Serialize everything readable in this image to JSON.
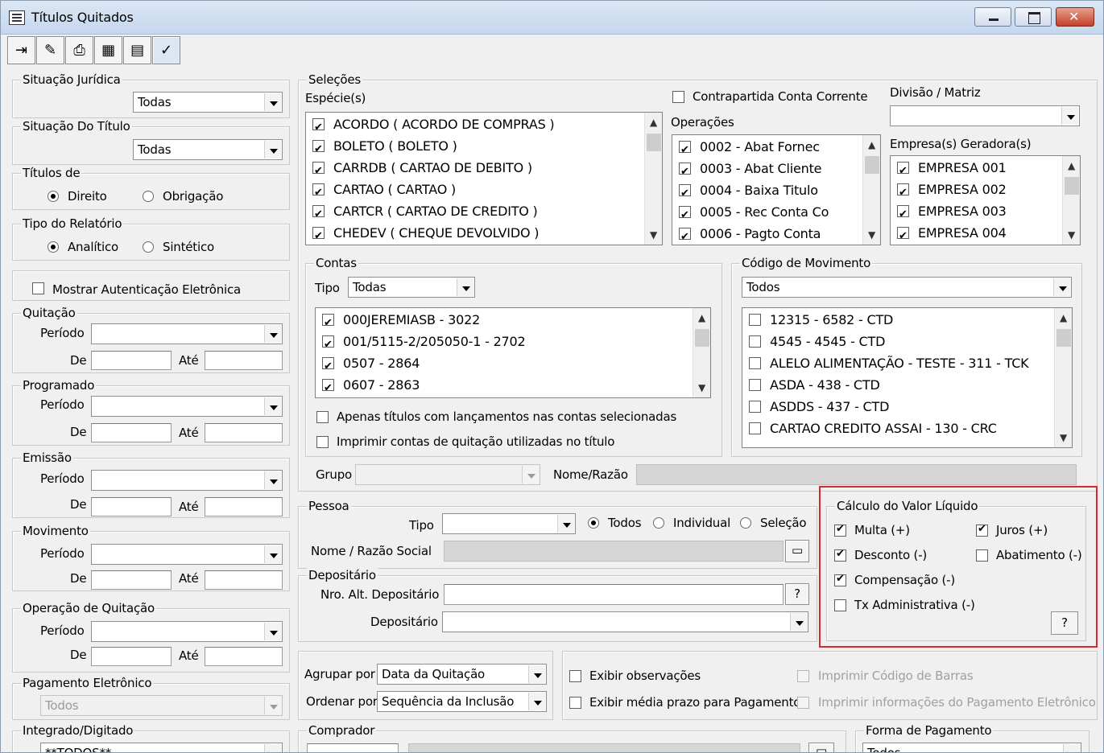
{
  "window": {
    "title": "Títulos Quitados"
  },
  "toolbar": {
    "buttons": [
      {
        "icon": "exit-icon"
      },
      {
        "icon": "eraser-icon"
      },
      {
        "icon": "printer-icon"
      },
      {
        "icon": "spreadsheet-icon"
      },
      {
        "icon": "report-icon"
      },
      {
        "icon": "confirm-icon"
      }
    ]
  },
  "left": {
    "situacao_juridica": {
      "title": "Situação Jurídica",
      "value": "Todas"
    },
    "situacao_titulo": {
      "title": "Situação Do Título",
      "value": "Todas"
    },
    "titulos_de": {
      "title": "Títulos de",
      "options": [
        "Direito",
        "Obrigação"
      ],
      "selected": "Direito"
    },
    "tipo_relatorio": {
      "title": "Tipo do Relatório",
      "options": [
        "Analítico",
        "Sintético"
      ],
      "selected": "Analítico"
    },
    "mostrar_autenticacao": {
      "label": "Mostrar Autenticação Eletrônica",
      "checked": false
    },
    "periodo_label": "Período",
    "de_label": "De",
    "ate_label": "Até",
    "quitacao": {
      "title": "Quitação"
    },
    "programado": {
      "title": "Programado"
    },
    "emissao": {
      "title": "Emissão"
    },
    "movimento": {
      "title": "Movimento"
    },
    "operacao_quitacao": {
      "title": "Operação de Quitação"
    },
    "pagamento_eletronico": {
      "title": "Pagamento Eletrônico",
      "value": "Todos"
    },
    "integrado": {
      "title": "Integrado/Digitado",
      "value": "**TODOS**"
    }
  },
  "selecoes": {
    "title": "Seleções",
    "especies": {
      "label": "Espécie(s)",
      "items": [
        {
          "text": "ACORDO ( ACORDO DE COMPRAS )",
          "checked": true
        },
        {
          "text": "BOLETO ( BOLETO )",
          "checked": true
        },
        {
          "text": "CARRDB ( CARTAO DE DEBITO )",
          "checked": true
        },
        {
          "text": "CARTAO ( CARTAO )",
          "checked": true
        },
        {
          "text": "CARTCR ( CARTAO DE CREDITO )",
          "checked": true
        },
        {
          "text": "CHEDEV ( CHEQUE DEVOLVIDO )",
          "checked": true
        }
      ]
    },
    "contrapartida": {
      "label": "Contrapartida Conta Corrente",
      "checked": false
    },
    "operacoes": {
      "label": "Operações",
      "items": [
        {
          "text": "0002 - Abat Fornec",
          "checked": true
        },
        {
          "text": "0003 - Abat Cliente",
          "checked": true
        },
        {
          "text": "0004 - Baixa Titulo",
          "checked": true
        },
        {
          "text": "0005 - Rec Conta Co",
          "checked": true
        },
        {
          "text": "0006 - Pagto Conta",
          "checked": true
        }
      ]
    },
    "divisao": {
      "label": "Divisão / Matriz",
      "value": ""
    },
    "empresas": {
      "label": "Empresa(s) Geradora(s)",
      "items": [
        {
          "text": "EMPRESA 001",
          "checked": true
        },
        {
          "text": "EMPRESA 002",
          "checked": true
        },
        {
          "text": "EMPRESA 003",
          "checked": true
        },
        {
          "text": "EMPRESA 004",
          "checked": true
        }
      ]
    },
    "contas": {
      "title": "Contas",
      "tipo_label": "Tipo",
      "tipo_value": "Todas",
      "items": [
        {
          "text": "000JEREMIASB - 3022",
          "checked": true
        },
        {
          "text": "001/5115-2/205050-1 - 2702",
          "checked": true
        },
        {
          "text": "0507 - 2864",
          "checked": true
        },
        {
          "text": "0607 - 2863",
          "checked": true
        }
      ],
      "apenas_label": "Apenas títulos com lançamentos nas contas selecionadas",
      "imprimir_contas_label": "Imprimir contas de quitação utilizadas no título"
    },
    "codigo_movimento": {
      "title": "Código de Movimento",
      "value": "Todos",
      "items": [
        {
          "text": "12315 - 6582 - CTD",
          "checked": false
        },
        {
          "text": "4545 - 4545 - CTD",
          "checked": false
        },
        {
          "text": "ALELO ALIMENTAÇÃO - TESTE - 311 - TCK",
          "checked": false
        },
        {
          "text": "ASDA - 438 - CTD",
          "checked": false
        },
        {
          "text": "ASDDS - 437 - CTD",
          "checked": false
        },
        {
          "text": "CARTAO CREDITO ASSAI - 130 - CRC",
          "checked": false
        }
      ]
    },
    "grupo_label": "Grupo",
    "nome_razao_label": "Nome/Razão"
  },
  "pessoa": {
    "title": "Pessoa",
    "tipo_label": "Tipo",
    "radios": [
      "Todos",
      "Individual",
      "Seleção"
    ],
    "selected": "Todos",
    "nome_label": "Nome / Razão Social"
  },
  "depositario": {
    "title": "Depositário",
    "nro_label": "Nro. Alt. Depositário",
    "dep_label": "Depositário",
    "help": "?"
  },
  "calculo": {
    "title": "Cálculo do Valor Líquido",
    "items": [
      {
        "text": "Multa (+)",
        "checked": true
      },
      {
        "text": "Juros (+)",
        "checked": true
      },
      {
        "text": "Desconto (-)",
        "checked": true
      },
      {
        "text": "Abatimento (-)",
        "checked": false
      },
      {
        "text": "Compensação (-)",
        "checked": true
      },
      {
        "text": "Tx Administrativa (-)",
        "checked": false
      }
    ],
    "help": "?"
  },
  "agrupar": {
    "label": "Agrupar por",
    "value": "Data da Quitação"
  },
  "ordenar": {
    "label": "Ordenar por",
    "value": "Sequência da Inclusão"
  },
  "opcoes": {
    "exibir_obs": "Exibir observações",
    "exibir_media": "Exibir média prazo para Pagamento",
    "imprimir_codigo": "Imprimir Código de Barras",
    "imprimir_info": "Imprimir informações do Pagamento Eletrônico"
  },
  "comprador": {
    "title": "Comprador"
  },
  "forma_pagamento": {
    "title": "Forma de Pagamento",
    "value": "Todos"
  }
}
